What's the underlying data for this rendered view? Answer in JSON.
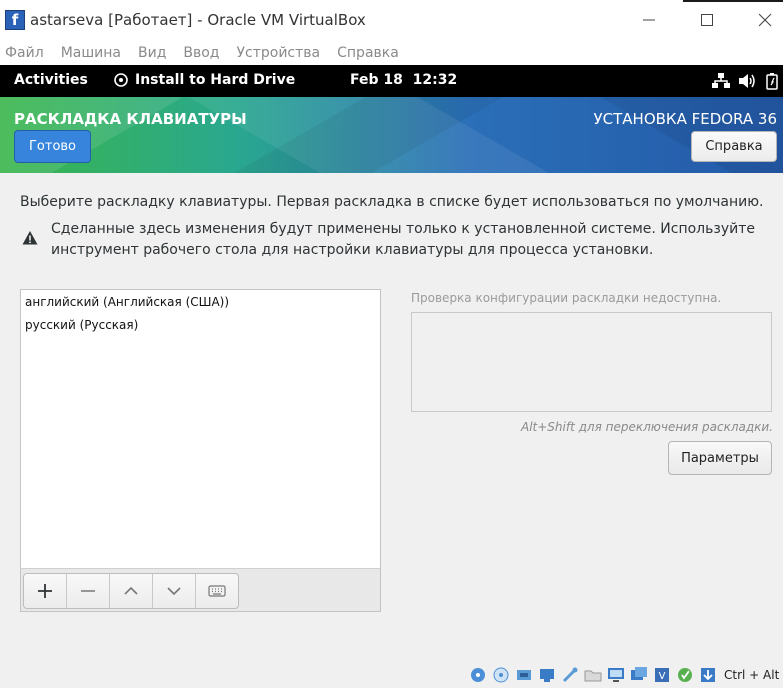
{
  "host_window": {
    "title": "astarseva [Работает] - Oracle VM VirtualBox",
    "logo_letter": "f",
    "menu": [
      "Файл",
      "Машина",
      "Вид",
      "Ввод",
      "Устройства",
      "Справка"
    ]
  },
  "gnome_bar": {
    "activities": "Activities",
    "app_name": "Install to Hard Drive",
    "clock": "Feb 18  12:32",
    "tray_icons": [
      "network-icon",
      "volume-icon",
      "battery-icon"
    ]
  },
  "header": {
    "spoke_title": "РАСКЛАДКА КЛАВИАТУРЫ",
    "product_title": "УСТАНОВКА FEDORA 36",
    "done_label": "Готово",
    "help_label": "Справка"
  },
  "content": {
    "intro": "Выберите раскладку клавиатуры. Первая раскладка в списке будет использоваться по умолчанию.",
    "warning": "Сделанные здесь изменения будут применены только к установленной системе. Используйте инструмент рабочего стола для настройки клавиатуры для процесса установки.",
    "layouts": [
      {
        "label": "английский (Английская (США))"
      },
      {
        "label": "русский (Русская)"
      }
    ],
    "toolbar_icons": [
      "add-icon",
      "remove-icon",
      "move-up-icon",
      "move-down-icon",
      "keyboard-preview-icon"
    ],
    "preview_unavailable": "Проверка конфигурации раскладки недоступна.",
    "switch_hint": "Alt+Shift для переключения раскладки.",
    "options_label": "Параметры"
  },
  "vbox_status": {
    "host_key": "Ctrl + Alt"
  },
  "colors": {
    "done_button": "#3684dc",
    "header_gradient_start": "#39b54a",
    "header_gradient_end": "#2359a8"
  }
}
